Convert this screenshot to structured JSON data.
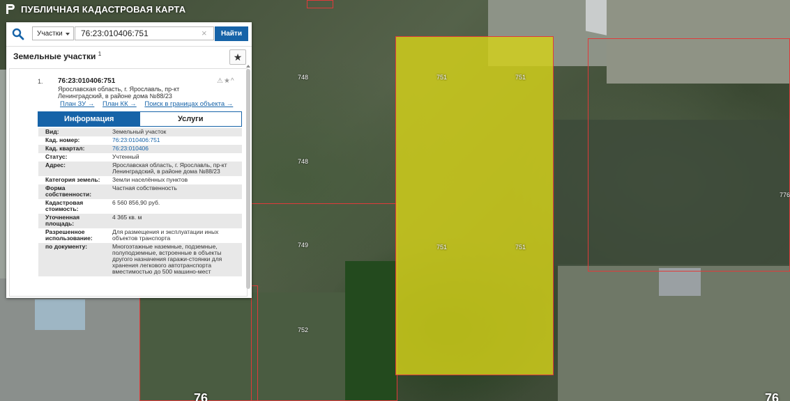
{
  "header": {
    "title": "ПУБЛИЧНАЯ КАДАСТРОВАЯ КАРТА"
  },
  "search": {
    "type_label": "Участки",
    "value": "76:23:010406:751",
    "clear": "×",
    "find_label": "Найти"
  },
  "list": {
    "title": "Земельные участки",
    "count": "1",
    "star": "★"
  },
  "result": {
    "index": "1.",
    "cad_number": "76:23:010406:751",
    "address": "Ярославская область, г. Ярославль, пр-кт Ленинградский, в районе дома №88/23",
    "icons": "⚠★^",
    "links": [
      "План ЗУ →",
      "План КК →",
      "Поиск в границах объекта →"
    ]
  },
  "tabs": [
    "Информация",
    "Услуги"
  ],
  "properties": [
    {
      "k": "Вид:",
      "v": "Земельный участок"
    },
    {
      "k": "Кад. номер:",
      "v": "76:23:010406:751",
      "link": true
    },
    {
      "k": "Кад. квартал:",
      "v": "76:23:010406",
      "link": true
    },
    {
      "k": "Статус:",
      "v": "Учтенный"
    },
    {
      "k": "Адрес:",
      "v": "Ярославская область, г. Ярославль, пр-кт Ленинградский, в районе дома №88/23"
    },
    {
      "k": "Категория земель:",
      "v": "Земли населённых пунктов"
    },
    {
      "k": "Форма собственности:",
      "v": "Частная собственность"
    },
    {
      "k": "Кадастровая стоимость:",
      "v": "6 560 856,90 руб."
    },
    {
      "k": "Уточненная площадь:",
      "v": "4 365 кв. м"
    },
    {
      "k": "Разрешенное использование:",
      "v": "Для размещения и эксплуатации иных объектов транспорта"
    },
    {
      "k": "по документу:",
      "v": "Многоэтажные наземные, подземные, полуподземные, встроенные в объекты другого назначения гаражи-стоянки для хранения легкового автотранспорта вместимостью до 500 машино-мест"
    }
  ],
  "map_labels": {
    "l748a": "748",
    "l748b": "748",
    "l749": "749",
    "l752": "752",
    "l751a": "751",
    "l751b": "751",
    "l751c": "751",
    "l751d": "751",
    "l776": "776",
    "b76a": "76",
    "b76b": "76"
  },
  "colors": {
    "accent": "#1663a8",
    "parcel_border": "#e03a3a",
    "selected_fill": "#d4d21a"
  }
}
